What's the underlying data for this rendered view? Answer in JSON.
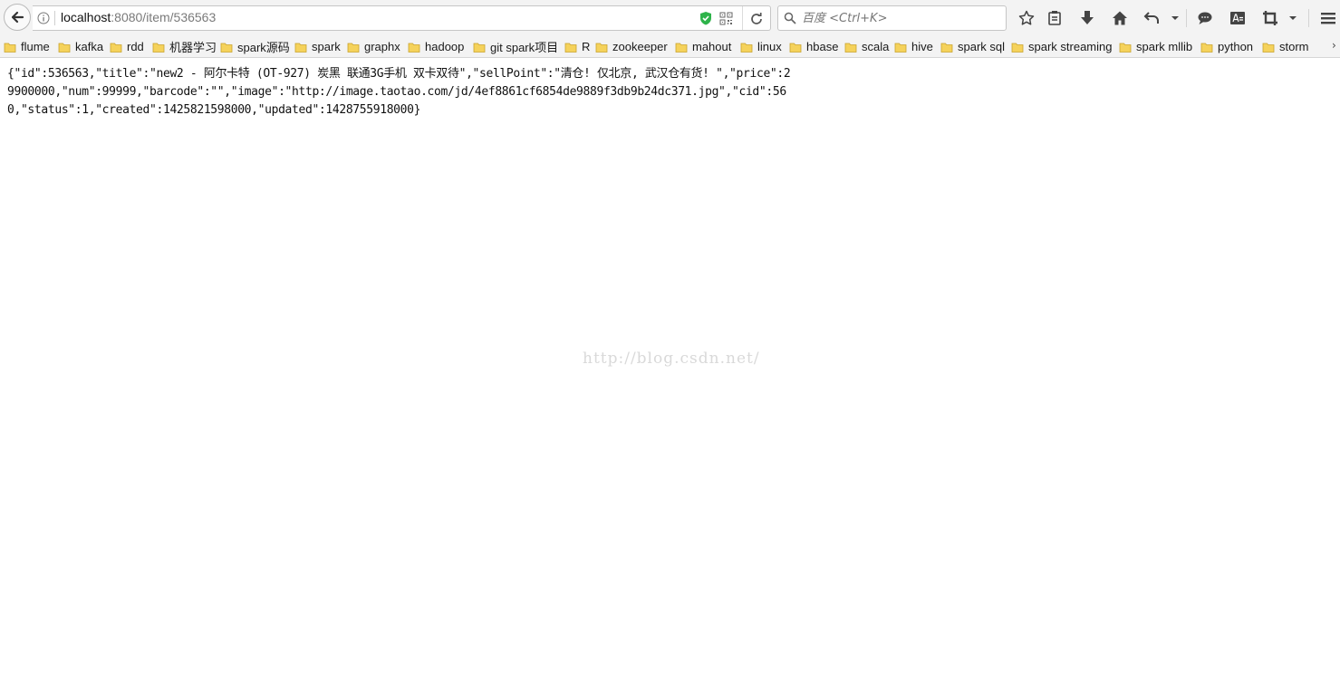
{
  "navbar": {
    "url_host": "localhost",
    "url_rest": ":8080/item/536563",
    "search_placeholder": "百度 <Ctrl+K>"
  },
  "bookmarks": [
    {
      "label": "flume"
    },
    {
      "label": "kafka"
    },
    {
      "label": "rdd"
    },
    {
      "label": "机器学习"
    },
    {
      "label": "spark源码"
    },
    {
      "label": "spark"
    },
    {
      "label": "graphx"
    },
    {
      "label": "hadoop"
    },
    {
      "label": "git spark项目"
    },
    {
      "label": "R"
    },
    {
      "label": "zookeeper"
    },
    {
      "label": "mahout"
    },
    {
      "label": "linux"
    },
    {
      "label": "hbase"
    },
    {
      "label": "scala"
    },
    {
      "label": "hive"
    },
    {
      "label": "spark sql"
    },
    {
      "label": "spark streaming"
    },
    {
      "label": "spark mllib"
    },
    {
      "label": "python"
    },
    {
      "label": "storm"
    }
  ],
  "bookmarks_overflow": "›",
  "content": {
    "json_text": "{\"id\":536563,\"title\":\"new2 - 阿尔卡特 (OT-927) 炭黑 联通3G手机 双卡双待\",\"sellPoint\":\"清仓! 仅北京, 武汉仓有货! \",\"price\":29900000,\"num\":99999,\"barcode\":\"\",\"image\":\"http://image.taotao.com/jd/4ef8861cf6854de9889f3db9b24dc371.jpg\",\"cid\":560,\"status\":1,\"created\":1425821598000,\"updated\":1428755918000}"
  },
  "watermark": "http://blog.csdn.net/",
  "colors": {
    "toolbar_bg": "#f3f3f3",
    "folder_yellow": "#f5d25b",
    "shield_green": "#2eb34a"
  }
}
